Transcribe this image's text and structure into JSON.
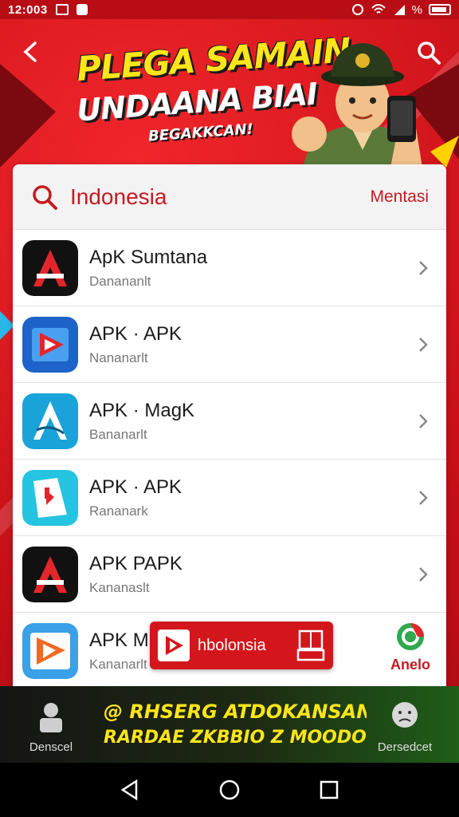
{
  "status_bar": {
    "time": "12:003",
    "signal_text": "%"
  },
  "header": {
    "title_line1": "PLEGA SAMAIN",
    "title_line2": "UNDAANA BIAI",
    "subtitle": "BEGAKKCAN!"
  },
  "search": {
    "query": "Indonesia",
    "action_label": "Mentasi"
  },
  "apps": [
    {
      "name": "ApK Sumtana",
      "sub": "Danananlt",
      "icon": "red-a-icon"
    },
    {
      "name": "APK · APK",
      "sub": "Nananarlt",
      "icon": "blue-play-icon"
    },
    {
      "name": "APK · MagK",
      "sub": "Bananarlt",
      "icon": "teal-a-icon"
    },
    {
      "name": "APK · APK",
      "sub": "Rananark",
      "icon": "cyan-book-icon"
    },
    {
      "name": "APK PAPK",
      "sub": "Kananaslt",
      "icon": "red-a-icon"
    },
    {
      "name": "APK M",
      "sub": "Kananarlt",
      "icon": "orange-play-icon"
    }
  ],
  "overlay_ad": {
    "label": "hbolonsia"
  },
  "side_badge": {
    "label": "Anelo"
  },
  "promo": {
    "left_label": "Denscel",
    "right_label": "Dersedcet",
    "line1": "@ RHSERG ATDOKANSANIN",
    "line2": "RARDAE ZKBBIO Z MOODO!"
  },
  "colors": {
    "primary": "#d9141b",
    "accent_yellow": "#ffe51a"
  }
}
